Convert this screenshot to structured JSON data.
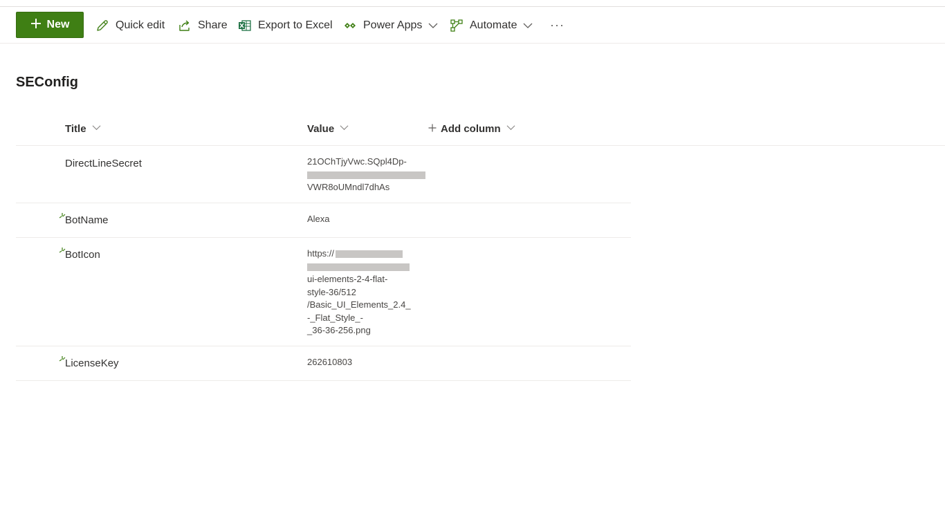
{
  "toolbar": {
    "new_label": "New",
    "quick_edit_label": "Quick edit",
    "share_label": "Share",
    "export_label": "Export to Excel",
    "power_apps_label": "Power Apps",
    "automate_label": "Automate",
    "more_label": "···"
  },
  "list": {
    "title": "SEConfig",
    "columns": {
      "title": "Title",
      "value": "Value",
      "add": "Add column"
    },
    "rows": [
      {
        "title": "DirectLineSecret",
        "value_line1": "21OChTjyVwc.SQpl4Dp-",
        "value_line3": "VWR8oUMndl7dhAs"
      },
      {
        "title": "BotName",
        "value": "Alexa"
      },
      {
        "title": "BotIcon",
        "value_line1": "https://",
        "value_line3": "ui-elements-2-4-flat-",
        "value_line4": "style-36/512",
        "value_line5": "/Basic_UI_Elements_2.4_",
        "value_line6": "-_Flat_Style_-",
        "value_line7": "_36-36-256.png"
      },
      {
        "title": "LicenseKey",
        "value": "262610803"
      }
    ]
  },
  "colors": {
    "accent": "#3f7f14",
    "excel_green": "#217346",
    "text": "#323130",
    "divider": "#edebe9"
  },
  "icons": {
    "new": "plus-icon",
    "quick_edit": "pencil-icon",
    "share": "share-icon",
    "export": "excel-icon",
    "power_apps": "power-apps-icon",
    "automate": "automate-icon",
    "new_item": "new-item-sparkle-icon"
  }
}
